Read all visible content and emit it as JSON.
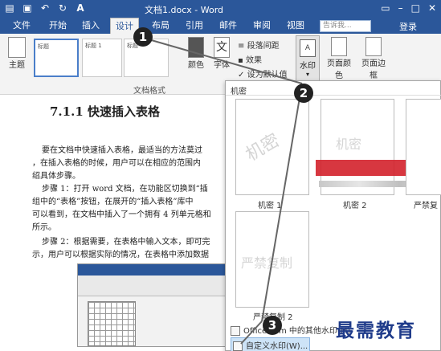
{
  "titlebar": {
    "title": "文档1.docx - Word",
    "qat_icons": [
      "word-doc-icon",
      "save-icon",
      "undo-icon",
      "redo-icon",
      "font-size-icon"
    ],
    "window_icons": [
      "ribbon-options-icon",
      "minimize-icon",
      "restore-icon",
      "close-icon"
    ]
  },
  "tabs": [
    {
      "label": "文件"
    },
    {
      "label": "开始"
    },
    {
      "label": "插入"
    },
    {
      "label": "设计",
      "active": true
    },
    {
      "label": "布局"
    },
    {
      "label": "引用"
    },
    {
      "label": "邮件"
    },
    {
      "label": "审阅"
    },
    {
      "label": "视图"
    }
  ],
  "tellme": {
    "placeholder": "告诉我..."
  },
  "login": "登录",
  "ribbon": {
    "theme_label": "主题",
    "gallery_items": [
      "标题",
      "标题 1",
      "标题"
    ],
    "group_doc_format": "文档格式",
    "colors_label": "颜色",
    "fonts_label": "字体",
    "paragraph_spacing": "段落间距",
    "effects": "效果",
    "set_default": "设为默认值",
    "watermark_label": "水印",
    "page_color_label": "页面颜色",
    "page_border_label": "页面边框"
  },
  "document": {
    "heading": "7.1.1 快速插入表格",
    "lines": [
      "要在文档中快速插入表格，最适当的方法莫过",
      "，在插入表格的时候，用户可以在相应的范围内",
      "绍具体步骤。",
      "步骤 1：打开 word 文档，在功能区切换到“插",
      "组中的“表格”按钮，在展开的“插入表格”库中",
      "可以看到，在文档中插入了一个拥有 4 列单元格和",
      "所示。",
      "步骤 2：根据需要，在表格中输入文本，即可完",
      "示，用户可以根据实际的情况，在表格中添加数据"
    ]
  },
  "dropdown": {
    "section": "机密",
    "thumbs": [
      {
        "label": "机密 1",
        "watermark": "机密"
      },
      {
        "label": "机密 2",
        "watermark": "机密"
      },
      {
        "label": "严禁复",
        "watermark": ""
      },
      {
        "label": "严禁复制 2",
        "watermark": "严禁复制"
      }
    ],
    "menu_office": "Office.com 中的其他水印(M)",
    "menu_custom": "自定义水印(W)..."
  },
  "callouts": [
    "1",
    "2",
    "3"
  ],
  "brand": "最需教育"
}
